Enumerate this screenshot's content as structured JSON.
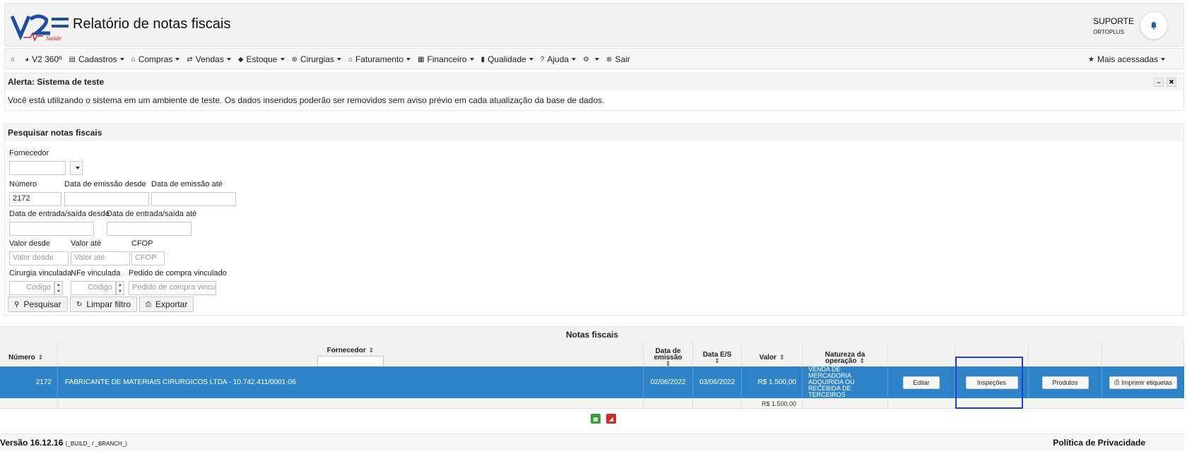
{
  "header": {
    "logo_text": "V2 Saúde",
    "title": "Relatório de notas fiscais",
    "user_name": "SUPORTE",
    "user_company": "ORTOPLUS"
  },
  "nav": {
    "items": [
      {
        "label": "",
        "icon": "home-icon",
        "caret": false
      },
      {
        "label": "V2 360º",
        "icon": "pie-chart-icon",
        "caret": false
      },
      {
        "label": "Cadastros",
        "icon": "save-icon",
        "caret": true
      },
      {
        "label": "Compras",
        "icon": "bank-icon",
        "caret": true
      },
      {
        "label": "Vendas",
        "icon": "exchange-icon",
        "caret": true
      },
      {
        "label": "Estoque",
        "icon": "tag-icon",
        "caret": true
      },
      {
        "label": "Cirurgias",
        "icon": "plus-circle-icon",
        "caret": true
      },
      {
        "label": "Faturamento",
        "icon": "bank-icon",
        "caret": true
      },
      {
        "label": "Financeiro",
        "icon": "calculator-icon",
        "caret": true
      },
      {
        "label": "Qualidade",
        "icon": "book-icon",
        "caret": true
      },
      {
        "label": "Ajuda",
        "icon": "question-icon",
        "caret": true
      },
      {
        "label": "",
        "icon": "gear-icon",
        "caret": true
      },
      {
        "label": "Sair",
        "icon": "close-circle-icon",
        "caret": false
      }
    ],
    "most_accessed": "Mais acessadas"
  },
  "alert": {
    "title": "Alerta: Sistema de teste",
    "message": "Você está utilizando o sistema em um ambiente de teste. Os dados inseridos poderão ser removidos sem aviso prévio em cada atualização da base de dados."
  },
  "search": {
    "title": "Pesquisar notas fiscais",
    "fornecedor_label": "Fornecedor",
    "fornecedor_value": "",
    "numero_label": "Número",
    "numero_value": "2172",
    "emissao_desde_label": "Data de emissão desde",
    "emissao_ate_label": "Data de emissão até",
    "entrada_desde_label": "Data de entrada/saída desde",
    "entrada_ate_label": "Data de entrada/saída até",
    "valor_desde_label": "Valor desde",
    "valor_desde_placeholder": "Valor desde",
    "valor_ate_label": "Valor até",
    "valor_ate_placeholder": "Valor até",
    "cfop_label": "CFOP",
    "cfop_placeholder": "CFOP",
    "cirurgia_label": "Cirurgia vinculada",
    "cirurgia_placeholder": "Código",
    "nfe_label": "NFe vinculada",
    "nfe_placeholder": "Código",
    "pedido_label": "Pedido de compra vinculado",
    "pedido_placeholder": "Pedido de compra vinculado",
    "btn_search": "Pesquisar",
    "btn_clear": "Limpar filtro",
    "btn_export": "Exportar"
  },
  "results": {
    "title": "Notas fiscais",
    "columns": {
      "numero": "Número",
      "fornecedor": "Fornecedor",
      "data_emissao_1": "Data de",
      "data_emissao_2": "emissão",
      "data_es": "Data E/S",
      "valor": "Valor",
      "natureza_1": "Natureza da",
      "natureza_2": "operação"
    },
    "row": {
      "numero": "2172",
      "fornecedor": "FABRICANTE DE MATERIAIS CIRURGICOS LTDA - 10.742.411/0001-06",
      "data_emissao": "02/06/2022",
      "data_es": "03/06/2022",
      "valor": "R$ 1.500,00",
      "natureza": "VENDA DE MERCADORIA ADQUIRIDA OU RECEBIDA DE TERCEIROS",
      "btn_editar": "Editar",
      "btn_inspecoes": "Inspeções",
      "btn_produtos": "Produtos",
      "btn_imprimir": "Imprimir etiquetas"
    },
    "total_valor": "R$ 1.500,00"
  },
  "footer": {
    "version": "Versão 16.12.16",
    "build": "(_BUILD_ / _BRANCH_)",
    "privacy": "Política de Privacidade"
  },
  "colors": {
    "selected_row": "#2f84c7",
    "highlight_box": "#1d3fd6",
    "logo_blue": "#1f4e9c",
    "logo_red": "#c62828"
  }
}
